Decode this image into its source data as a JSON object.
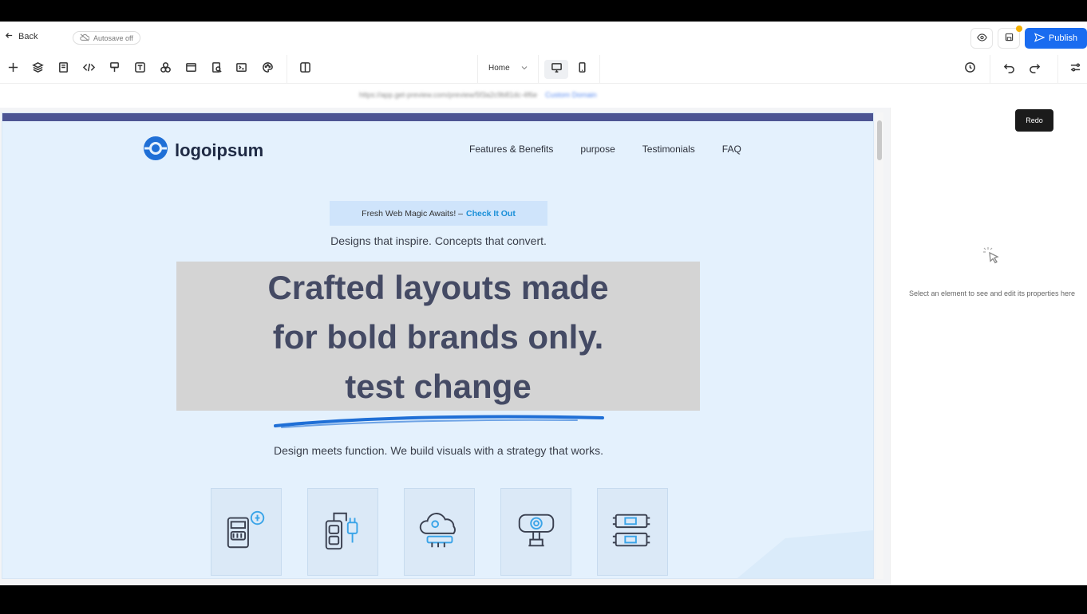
{
  "topbar": {
    "back_label": "Back",
    "autosave_label": "Autosave off",
    "publish_label": "Publish"
  },
  "toolbar": {
    "page_name": "Home",
    "redo_tooltip": "Redo"
  },
  "urlbar": {
    "url_text": "https://app.get-preview.com/preview/5f3a2c9b81dc-4f6e",
    "link_text": "Custom Domain"
  },
  "site": {
    "logo_text": "logoipsum",
    "nav": [
      "Features & Benefits",
      "purpose",
      "Testimonials",
      "FAQ"
    ],
    "banner_text": "Fresh Web Magic Awaits! –",
    "banner_cta": "Check It Out",
    "tagline": "Designs that inspire. Concepts that convert.",
    "hero_lines": [
      "Crafted layouts made",
      "for bold brands only.",
      "test change"
    ],
    "subtext": "Design meets function. We build visuals with a strategy that works.",
    "cards": [
      "battery-meter-icon",
      "power-plug-icon",
      "cloud-server-icon",
      "webcam-icon",
      "circuit-boards-icon"
    ]
  },
  "panel": {
    "message": "Select an element to see and edit its properties here"
  },
  "colors": {
    "accent": "#1a6cf0",
    "hero_bg": "#d4d4d4",
    "canvas_bg": "#e4f1fd",
    "top_strip": "#4d5593"
  }
}
